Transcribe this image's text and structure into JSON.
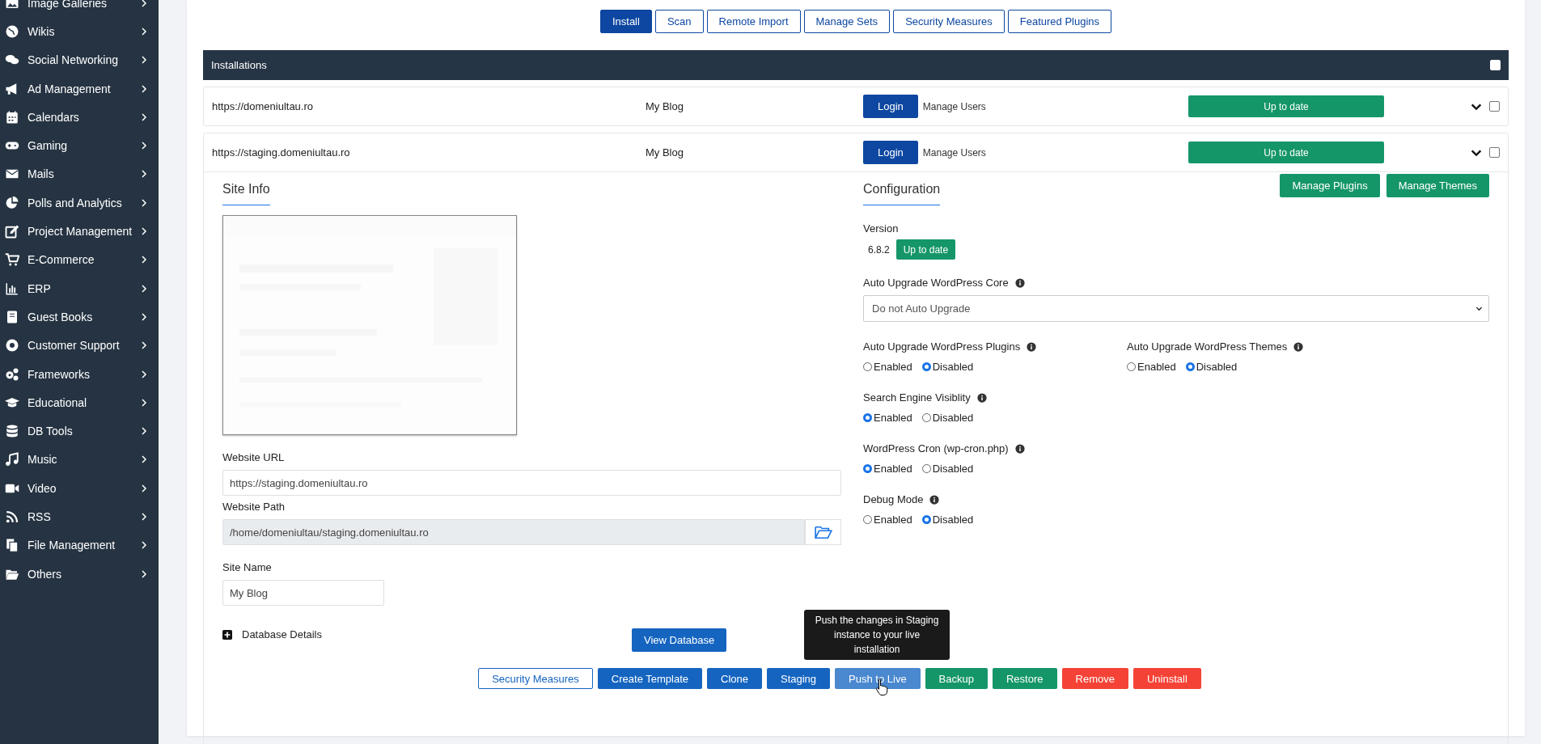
{
  "sidebar": {
    "items": [
      {
        "label": "Image Galleries"
      },
      {
        "label": "Wikis"
      },
      {
        "label": "Social Networking"
      },
      {
        "label": "Ad Management"
      },
      {
        "label": "Calendars"
      },
      {
        "label": "Gaming"
      },
      {
        "label": "Mails"
      },
      {
        "label": "Polls and Analytics"
      },
      {
        "label": "Project Management"
      },
      {
        "label": "E-Commerce"
      },
      {
        "label": "ERP"
      },
      {
        "label": "Guest Books"
      },
      {
        "label": "Customer Support"
      },
      {
        "label": "Frameworks"
      },
      {
        "label": "Educational"
      },
      {
        "label": "DB Tools"
      },
      {
        "label": "Music"
      },
      {
        "label": "Video"
      },
      {
        "label": "RSS"
      },
      {
        "label": "File Management"
      },
      {
        "label": "Others"
      }
    ]
  },
  "tabs": [
    {
      "label": "Install",
      "selected": true
    },
    {
      "label": "Scan",
      "selected": false
    },
    {
      "label": "Remote Import",
      "selected": false
    },
    {
      "label": "Manage Sets",
      "selected": false
    },
    {
      "label": "Security Measures",
      "selected": false
    },
    {
      "label": "Featured Plugins",
      "selected": false
    }
  ],
  "installations": {
    "title": "Installations",
    "checked": false,
    "rows": [
      {
        "url": "https://domeniultau.ro",
        "name": "My Blog",
        "login": "Login",
        "manage": "Manage Users",
        "status": "Up to date",
        "checked": false
      },
      {
        "url": "https://staging.domeniultau.ro",
        "name": "My Blog",
        "login": "Login",
        "manage": "Manage Users",
        "status": "Up to date",
        "checked": false
      }
    ]
  },
  "site_info": {
    "title": "Site Info",
    "website_url_label": "Website URL",
    "website_url": "https://staging.domeniultau.ro",
    "website_path_label": "Website Path",
    "website_path": "/home/domeniultau/staging.domeniultau.ro",
    "site_name_label": "Site Name",
    "site_name": "My Blog",
    "database_details": "Database Details",
    "view_database": "View Database"
  },
  "configuration": {
    "title": "Configuration",
    "buttons": [
      "Manage Plugins",
      "Manage Themes"
    ],
    "version_label": "Version",
    "version": "6.8.2",
    "version_status": "Up to date",
    "core_label": "Auto Upgrade WordPress Core",
    "core_value": "Do not Auto Upgrade",
    "options": [
      {
        "label": "Auto Upgrade WordPress Plugins",
        "choices": [
          {
            "label": "Enabled",
            "selected": false
          },
          {
            "label": "Disabled",
            "selected": true
          }
        ]
      },
      {
        "label": "Auto Upgrade WordPress Themes",
        "choices": [
          {
            "label": "Enabled",
            "selected": false
          },
          {
            "label": "Disabled",
            "selected": true
          }
        ]
      },
      {
        "label": "Search Engine Visiblity",
        "choices": [
          {
            "label": "Enabled",
            "selected": true
          },
          {
            "label": "Disabled",
            "selected": false
          }
        ]
      },
      {
        "label": "WordPress Cron (wp-cron.php)",
        "choices": [
          {
            "label": "Enabled",
            "selected": true
          },
          {
            "label": "Disabled",
            "selected": false
          }
        ]
      },
      {
        "label": "Debug Mode",
        "choices": [
          {
            "label": "Enabled",
            "selected": false
          },
          {
            "label": "Disabled",
            "selected": true
          }
        ]
      }
    ]
  },
  "actions": [
    {
      "label": "Security Measures",
      "kind": "outline"
    },
    {
      "label": "Create Template",
      "kind": "blue"
    },
    {
      "label": "Clone",
      "kind": "blue"
    },
    {
      "label": "Staging",
      "kind": "blue"
    },
    {
      "label": "Push to Live",
      "kind": "hover",
      "tooltip": "Push the changes in Staging instance to your live installation"
    },
    {
      "label": "Backup",
      "kind": "green"
    },
    {
      "label": "Restore",
      "kind": "green"
    },
    {
      "label": "Remove",
      "kind": "red"
    },
    {
      "label": "Uninstall",
      "kind": "red"
    }
  ]
}
